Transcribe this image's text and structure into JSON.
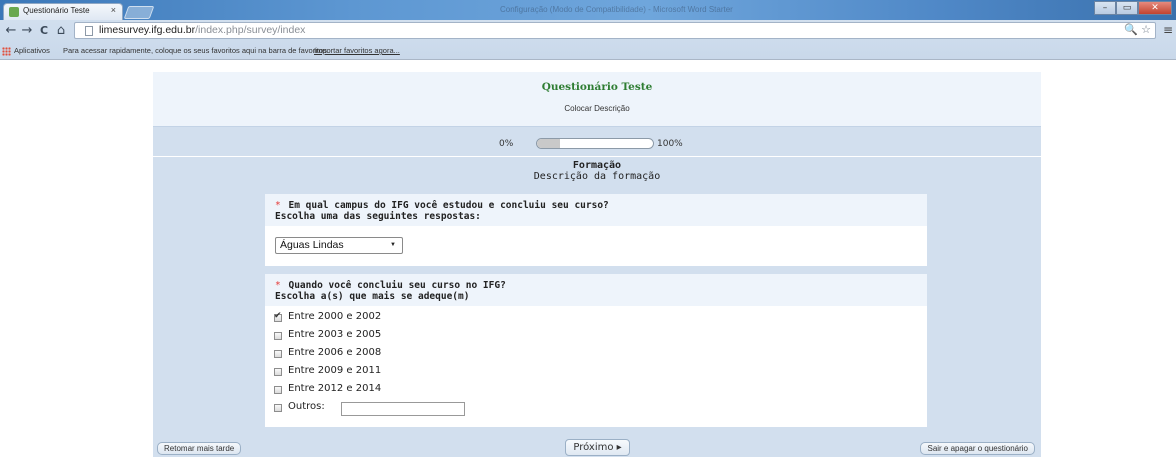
{
  "browser": {
    "tab_title": "Questionário Teste",
    "tab_close": "×",
    "window_title": "Configuração (Modo de Compatibilidade) - Microsoft Word Starter",
    "url_host": "limesurvey.ifg.edu.br",
    "url_path": "/index.php/survey/index",
    "nav": {
      "back": "←",
      "forward": "→",
      "reload": "C",
      "home": "⌂"
    },
    "omni_icons": "🔍 ☆",
    "menu": "≡",
    "window_buttons": {
      "minimize": "–",
      "maximize": "▭",
      "close": "✕"
    }
  },
  "bookmarks": {
    "apps_label": "Aplicativos",
    "hint": "Para acessar rapidamente, coloque os seus favoritos aqui na barra de favoritos.",
    "import_link": "Importar favoritos agora..."
  },
  "survey": {
    "title": "Questionário Teste",
    "description": "Colocar Descrição",
    "progress": {
      "left_label": "0%",
      "right_label": "100%",
      "value_percent": 20
    },
    "group": {
      "title": "Formação",
      "description": "Descrição da formação"
    },
    "questions": [
      {
        "required_mark": "*",
        "text": "Em qual campus do IFG você estudou e concluiu seu curso?",
        "help": "Escolha uma das seguintes respostas:",
        "selected_value": "Águas Lindas"
      },
      {
        "required_mark": "*",
        "text": "Quando você concluiu seu curso no IFG?",
        "help": "Escolha a(s) que mais se adeque(m)",
        "options": [
          {
            "label": "Entre 2000 e 2002",
            "checked": true
          },
          {
            "label": "Entre 2003 e 2005",
            "checked": false
          },
          {
            "label": "Entre 2006 e 2008",
            "checked": false
          },
          {
            "label": "Entre 2009 e 2011",
            "checked": false
          },
          {
            "label": "Entre 2012 e 2014",
            "checked": false
          },
          {
            "label": "Outros:",
            "checked": false
          }
        ],
        "other_value": ""
      }
    ],
    "buttons": {
      "resume_later": "Retomar mais tarde",
      "next": "Próximo ▸",
      "exit_clear": "Sair e apagar o questionário"
    }
  }
}
